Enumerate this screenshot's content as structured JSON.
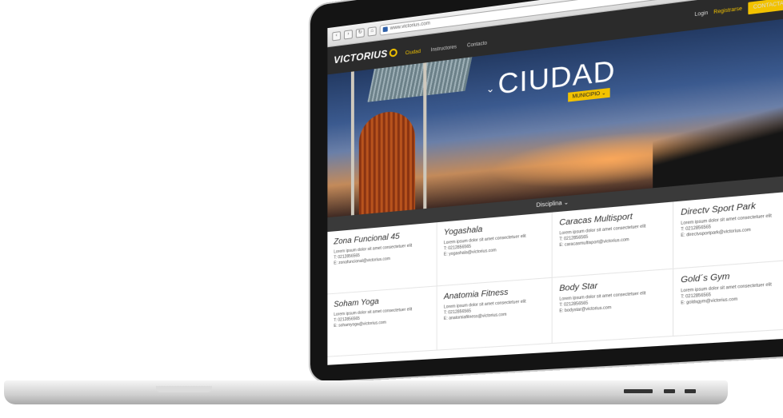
{
  "browser": {
    "url": "www.victorius.com"
  },
  "site": {
    "logo": "VICTORIUS",
    "menu": [
      "Ciudad",
      "Instructores",
      "Contacto"
    ],
    "login": "Login",
    "register": "Registrarse",
    "contact_button": "CONTACTAR"
  },
  "hero": {
    "title": "CIUDAD",
    "municipio": "MUNICIPIO"
  },
  "discipline": {
    "label": "Disciplina"
  },
  "gyms": [
    {
      "name": "Zona Funcional 45",
      "desc": "Lorem ipsum dolor sit amet consectetuer elit",
      "phone": "T: 0212856565",
      "email": "E: zonafuncional@victorius.com"
    },
    {
      "name": "Yogashala",
      "desc": "Lorem ipsum dolor sit amet consectetuer elit",
      "phone": "T: 0212856565",
      "email": "E: yogashala@victorius.com"
    },
    {
      "name": "Caracas Multisport",
      "desc": "Lorem ipsum dolor sit amet consectetuer elit",
      "phone": "T: 0212856565",
      "email": "E: caracasmultisport@victorius.com"
    },
    {
      "name": "Directv Sport Park",
      "desc": "Lorem ipsum dolor sit amet consectetuer elit",
      "phone": "T: 0212856565",
      "email": "E: directvsportpark@victorius.com"
    },
    {
      "name": "Soham Yoga",
      "desc": "Lorem ipsum dolor sit amet consectetuer elit",
      "phone": "T: 0212856565",
      "email": "E: sohamyoga@victorius.com"
    },
    {
      "name": "Anatomia Fitness",
      "desc": "Lorem ipsum dolor sit amet consectetuer elit",
      "phone": "T: 0212856565",
      "email": "E: anatomiafitness@victorius.com"
    },
    {
      "name": "Body Star",
      "desc": "Lorem ipsum dolor sit amet consectetuer elit",
      "phone": "T: 0212856565",
      "email": "E: bodystar@victorius.com"
    },
    {
      "name": "Gold´s Gym",
      "desc": "Lorem ipsum dolor sit amet consectetuer elit",
      "phone": "T: 0212856565",
      "email": "E: goldsgym@victorius.com"
    }
  ]
}
